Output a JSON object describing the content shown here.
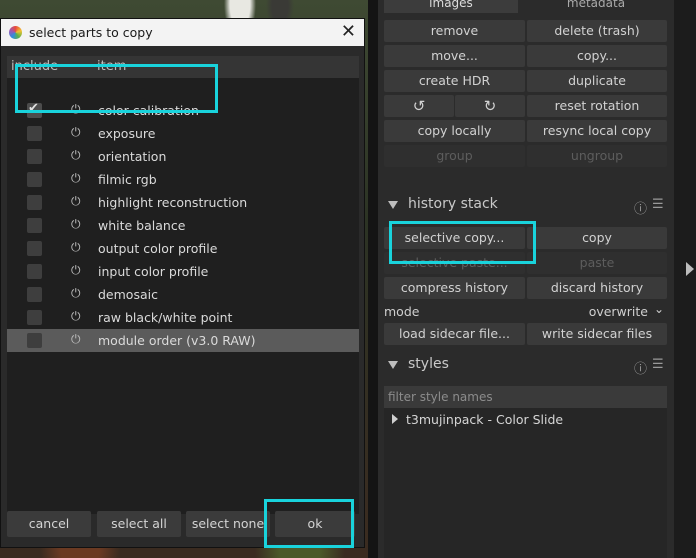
{
  "dialog": {
    "title": "select parts to copy",
    "columns": {
      "include": "include",
      "item": "item"
    },
    "modules": [
      {
        "name": "color calibration",
        "checked": true
      },
      {
        "name": "exposure",
        "checked": false
      },
      {
        "name": "orientation",
        "checked": false
      },
      {
        "name": "filmic rgb",
        "checked": false
      },
      {
        "name": "highlight reconstruction",
        "checked": false
      },
      {
        "name": "white balance",
        "checked": false
      },
      {
        "name": "output color profile",
        "checked": false
      },
      {
        "name": "input color profile",
        "checked": false
      },
      {
        "name": "demosaic",
        "checked": false
      },
      {
        "name": "raw black/white point",
        "checked": false
      },
      {
        "name": "module order (v3.0 RAW)",
        "checked": false
      }
    ],
    "buttons": {
      "cancel": "cancel",
      "select_all": "select all",
      "select_none": "select none",
      "ok": "ok"
    }
  },
  "panel": {
    "tabs": {
      "images": "images",
      "metadata": "metadata"
    },
    "images": {
      "remove": "remove",
      "delete": "delete (trash)",
      "move": "move...",
      "copy": "copy...",
      "create_hdr": "create HDR",
      "duplicate": "duplicate",
      "reset_rotation": "reset rotation",
      "copy_locally": "copy locally",
      "resync": "resync local copy",
      "group": "group",
      "ungroup": "ungroup"
    },
    "history": {
      "title": "history stack",
      "selective_copy": "selective copy...",
      "copy": "copy",
      "selective_paste": "selective paste...",
      "paste": "paste",
      "compress": "compress history",
      "discard": "discard history",
      "mode_label": "mode",
      "mode_value": "overwrite",
      "load_sidecar": "load sidecar file...",
      "write_sidecar": "write sidecar files"
    },
    "styles": {
      "title": "styles",
      "filter_placeholder": "filter style names",
      "items": [
        "t3mujinpack - Color Slide"
      ]
    }
  },
  "icons": {
    "power": "power-icon",
    "info": "info-icon",
    "menu": "hamburger-icon",
    "rotate_left": "rotate-left-icon",
    "rotate_right": "rotate-right-icon"
  },
  "colors": {
    "highlight": "#19d3dc"
  }
}
